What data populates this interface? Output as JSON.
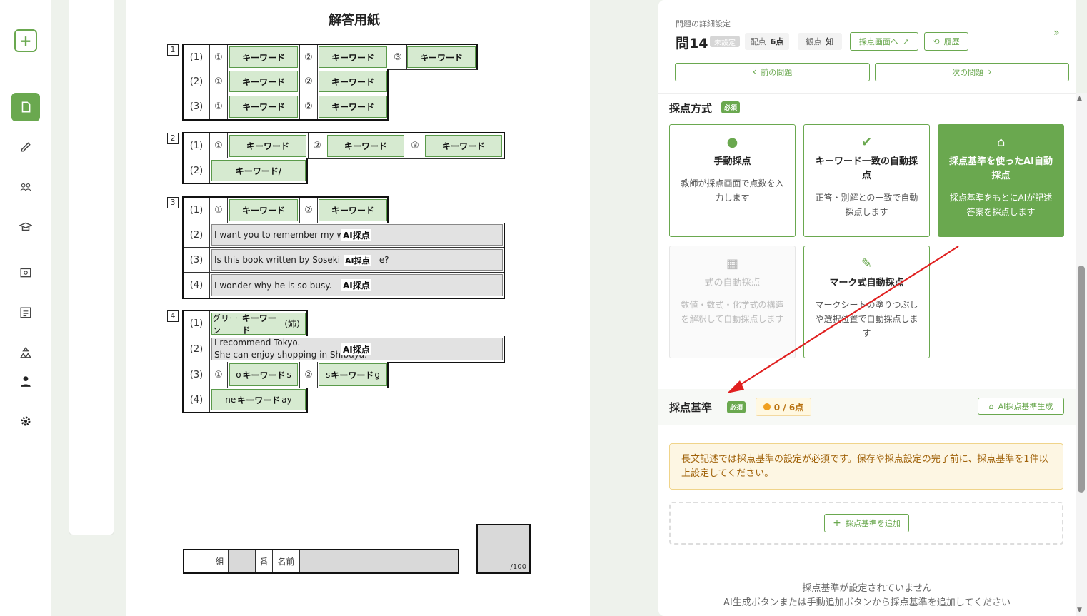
{
  "paper": {
    "title": "解答用紙",
    "section_numbers": [
      "1",
      "2",
      "3",
      "4"
    ],
    "rows": {
      "s1": [
        "(1)",
        "(2)",
        "(3)"
      ],
      "s2": [
        "(1)",
        "(2)"
      ],
      "s3": [
        "(1)",
        "(2)",
        "(3)",
        "(4)"
      ],
      "s4": [
        "(1)",
        "(2)",
        "(3)",
        "(4)"
      ]
    },
    "circled": {
      "c1": "①",
      "c2": "②",
      "c3": "③"
    },
    "keyword": "キーワード",
    "keyword_slash": "キーワード/",
    "ai_label": "AI採点",
    "s3_texts": {
      "r2": "I want you to remember my w",
      "r3": "Is this book written by Soseki N",
      "r3_tail": "e?",
      "r4": "I wonder why he is so busy."
    },
    "s4_texts": {
      "r1_pre": "グリーン",
      "r1_post": "（姉）",
      "r2a": "I recommend Tokyo.",
      "r2b": "She can enjoy shopping in Shibuya.",
      "r3_pre": "o",
      "r3_post": "s",
      "r3b_pre": "s",
      "r3b_post": "g",
      "r4_pre": "ne",
      "r4_post": "ay"
    },
    "footer": {
      "class_label": "組",
      "number_label": "番",
      "name_label": "名前",
      "score_total": "/100"
    }
  },
  "panel": {
    "heading": "問題の詳細設定",
    "question": "問14",
    "status": "未設定",
    "points_label": "配点",
    "points_value": "6点",
    "aspect_label": "観点",
    "aspect_value": "知",
    "grading_screen_button": "採点画面へ",
    "history_button": "履歴",
    "prev_button": "前の問題",
    "next_button": "次の問題",
    "method_title": "採点方式",
    "required": "必須",
    "cards": [
      {
        "title": "手動採点",
        "desc": "教師が採点画面で点数を入力します"
      },
      {
        "title": "キーワード一致の自動採点",
        "desc": "正答・別解との一致で自動採点します"
      },
      {
        "title": "採点基準を使ったAI自動採点",
        "desc": "採点基準をもとにAIが記述答案を採点します"
      },
      {
        "title": "式の自動採点",
        "desc": "数値・数式・化学式の構造を解釈して自動採点します"
      },
      {
        "title": "マーク式自動採点",
        "desc": "マークシートの塗りつぶしや選択位置で自動採点します"
      }
    ],
    "criteria_title": "採点基準",
    "criteria_points": "0 / 6点",
    "ai_generate_button": "AI採点基準生成",
    "warning": "長文記述では採点基準の設定が必須です。保存や採点設定の完了前に、採点基準を1件以上設定してください。",
    "add_button": "採点基準を追加",
    "empty_line1": "採点基準が設定されていません",
    "empty_line2": "AI生成ボタンまたは手動追加ボタンから採点基準を追加してください"
  },
  "colors": {
    "accent": "#6aa84f",
    "arrow": "#e02020",
    "warning_text": "#a0620a"
  }
}
